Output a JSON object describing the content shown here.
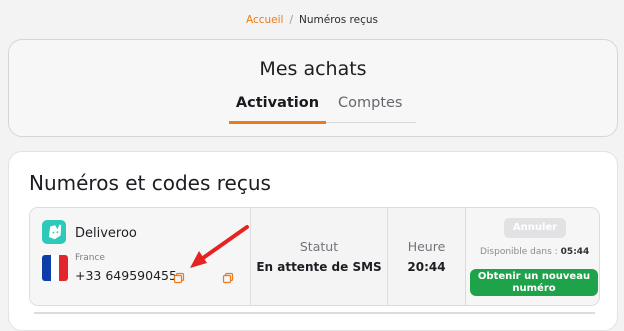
{
  "breadcrumb": {
    "home": "Accueil",
    "separator": "/",
    "current": "Numéros reçus"
  },
  "header": {
    "title": "Mes achats",
    "tabs": [
      {
        "label": "Activation",
        "active": true
      },
      {
        "label": "Comptes",
        "active": false
      }
    ]
  },
  "main": {
    "title": "Numéros et codes reçus",
    "orders": [
      {
        "service": "Deliveroo",
        "service_icon": "deliveroo-icon",
        "country": "France",
        "phone": "+33 649590455",
        "status_label": "Statut",
        "status_value": "En attente de SMS",
        "time_label": "Heure",
        "time_value": "20:44",
        "cancel_label": "Annuler",
        "available_label": "Disponible dans :",
        "available_value": "05:44",
        "new_number_line1": "Obtenir un nouveau",
        "new_number_line2": "numéro"
      }
    ]
  },
  "colors": {
    "accent": "#ea7b1a",
    "green": "#1fa34a",
    "arrow": "#e52421",
    "deliveroo": "#2ec9bb"
  }
}
